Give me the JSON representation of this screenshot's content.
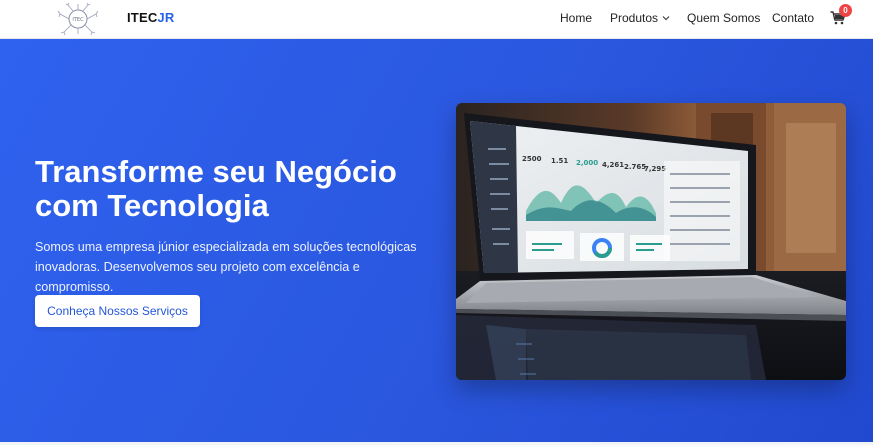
{
  "nav": {
    "brand_main": "ITEC",
    "brand_accent": "JR",
    "logo_icon": "itec-logo-icon",
    "items": [
      {
        "label": "Home"
      },
      {
        "label": "Produtos",
        "icon": "chevron-down-icon"
      },
      {
        "label": "Quem Somos"
      },
      {
        "label": "Contato"
      }
    ],
    "cart": {
      "icon": "cart-icon",
      "count": "0"
    }
  },
  "hero": {
    "title": "Transforme seu Negócio com Tecnologia",
    "subtitle": "Somos uma empresa júnior especializada em soluções tecnológicas inovadoras. Desenvolvemos seu projeto com excelência e compromisso.",
    "cta_label": "Conheça Nossos Serviços",
    "image": "laptop-dashboard-photo",
    "dashboard_stats": [
      "2500",
      "1.51",
      "2,000",
      "4,261",
      "2.765",
      "7,295"
    ]
  },
  "colors": {
    "accent": "#2563eb",
    "hero_bg": "#2a57de",
    "badge": "#ef4444"
  }
}
